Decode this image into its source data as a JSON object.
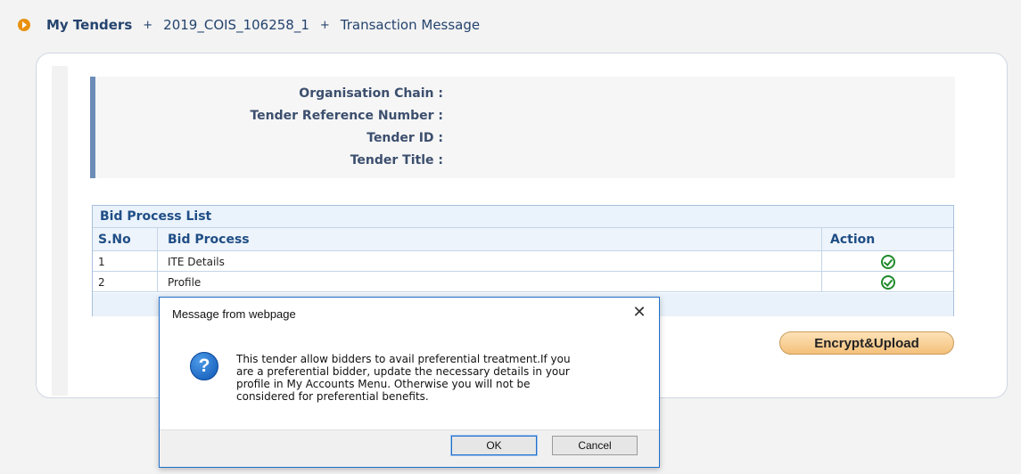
{
  "breadcrumb": {
    "items": [
      "My Tenders",
      "2019_COIS_106258_1",
      "Transaction Message"
    ],
    "separator": "+"
  },
  "tender_info": {
    "labels": [
      "Organisation Chain :",
      "Tender Reference Number :",
      "Tender ID :",
      "Tender Title :"
    ]
  },
  "bid_process": {
    "title": "Bid Process List",
    "columns": [
      "S.No",
      "Bid Process",
      "Action"
    ],
    "rows": [
      {
        "sno": "1",
        "process": "ITE Details"
      },
      {
        "sno": "2",
        "process": "Profile"
      }
    ]
  },
  "encrypt_button": "Encrypt&Upload",
  "dialog": {
    "title": "Message from webpage",
    "close_glyph": "✕",
    "icon_glyph": "?",
    "lines": [
      "This tender allow bidders to avail preferential treatment.If you",
      "are a preferential bidder, update the necessary details in your",
      "profile in My Accounts Menu. Otherwise you will not be",
      "considered for preferential benefits."
    ],
    "ok_label": "OK",
    "cancel_label": "Cancel"
  },
  "colors": {
    "accent_orange": "#e8910f",
    "header_blue": "#1f4e85",
    "dialog_border": "#1e6fcc",
    "check_green": "#1f8a2b"
  }
}
